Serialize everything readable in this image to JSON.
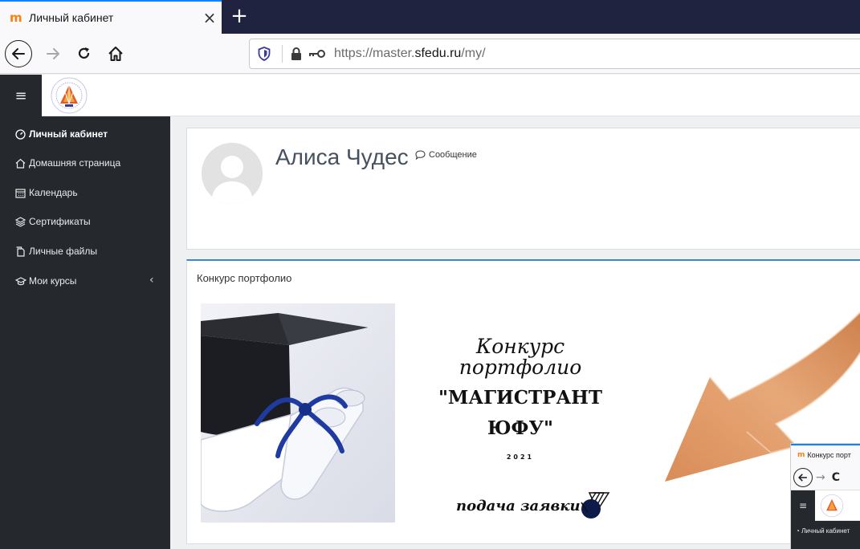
{
  "browser": {
    "tab_title": "Личный кабинет",
    "tab_favicon": "m",
    "new_tab_label": "+",
    "url_prefix": "https://master.",
    "url_domain": "sfedu.ru",
    "url_suffix": "/my/"
  },
  "header": {
    "menu_label": "≡"
  },
  "sidebar": {
    "items": [
      {
        "label": "Личный кабинет",
        "icon": "dashboard-icon"
      },
      {
        "label": "Домашняя страница",
        "icon": "home-icon"
      },
      {
        "label": "Календарь",
        "icon": "calendar-icon"
      },
      {
        "label": "Сертификаты",
        "icon": "layers-icon"
      },
      {
        "label": "Личные файлы",
        "icon": "file-icon"
      },
      {
        "label": "Мои курсы",
        "icon": "graduation-cap-icon"
      }
    ],
    "collapse_chevron": "‹"
  },
  "profile": {
    "name": "Алиса Чудес",
    "message_label": "Сообщение"
  },
  "block": {
    "title": "Конкурс портфолио",
    "banner": {
      "line1": "Конкурс",
      "line2": "портфолио",
      "line3": "\"МАГИСТРАНТ",
      "line4": "ЮФУ\"",
      "year": "2021",
      "apply": "подача заявки"
    }
  },
  "thumbnail": {
    "tab_title": "Конкурс порт",
    "sidebar_item": "Личный кабинет"
  },
  "colors": {
    "sidebar_bg": "#25292e",
    "accent": "#3d86d1",
    "arrow": "#e0a070"
  }
}
